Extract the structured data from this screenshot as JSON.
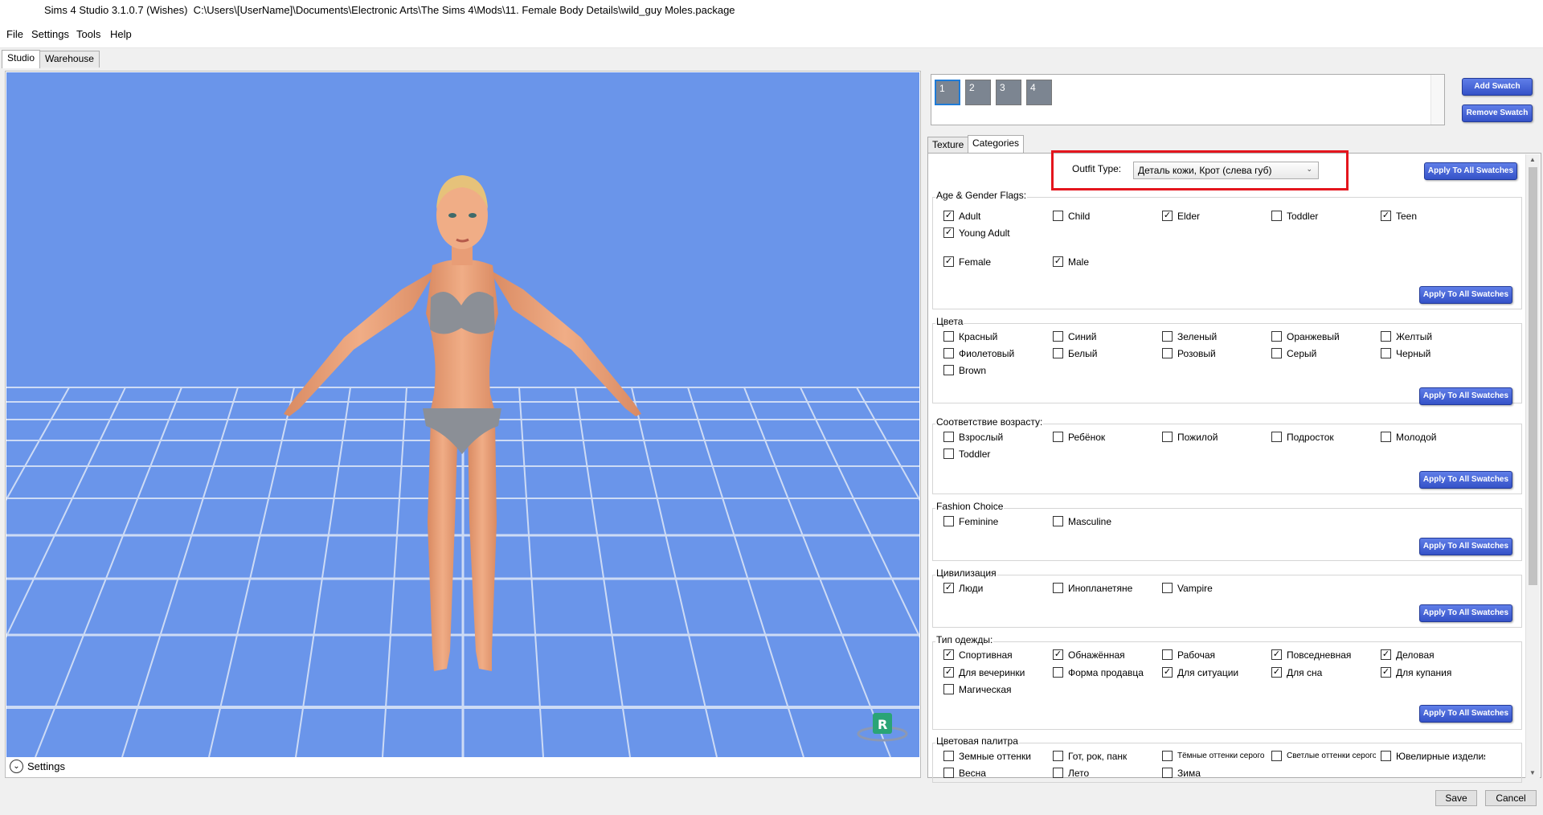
{
  "window": {
    "title": "Sims 4 Studio 3.1.0.7 (Wishes)  C:\\Users\\[UserName]\\Documents\\Electronic Arts\\The Sims 4\\Mods\\11. Female Body Details\\wild_guy Moles.package"
  },
  "menu": [
    "File",
    "Settings",
    "Tools",
    "Help"
  ],
  "main_tabs": [
    "Studio",
    "Warehouse"
  ],
  "viewport": {
    "settings_label": "Settings",
    "badge": "R"
  },
  "swatches": {
    "items": [
      "1",
      "2",
      "3",
      "4"
    ],
    "selected": "1",
    "add_label": "Add Swatch",
    "remove_label": "Remove Swatch"
  },
  "sub_tabs": [
    "Texture",
    "Categories"
  ],
  "outfit": {
    "label": "Outfit Type:",
    "value": "Деталь кожи, Крот (слева губ)"
  },
  "apply_label": "Apply To All Swatches",
  "groups": [
    {
      "label": "Age & Gender Flags:",
      "rows": [
        [
          {
            "t": "Adult",
            "c": true
          },
          {
            "t": "Child",
            "c": false
          },
          {
            "t": "Elder",
            "c": true
          },
          {
            "t": "Toddler",
            "c": false
          },
          {
            "t": "Teen",
            "c": true
          }
        ],
        [
          {
            "t": "Young Adult",
            "c": true
          }
        ],
        [],
        [
          {
            "t": "Female",
            "c": true
          },
          {
            "t": "Male",
            "c": true
          }
        ]
      ]
    },
    {
      "label": "Цвета",
      "rows": [
        [
          {
            "t": "Красный",
            "c": false
          },
          {
            "t": "Синий",
            "c": false
          },
          {
            "t": "Зеленый",
            "c": false
          },
          {
            "t": "Оранжевый",
            "c": false
          },
          {
            "t": "Желтый",
            "c": false
          }
        ],
        [
          {
            "t": "Фиолетовый",
            "c": false
          },
          {
            "t": "Белый",
            "c": false
          },
          {
            "t": "Розовый",
            "c": false
          },
          {
            "t": "Серый",
            "c": false
          },
          {
            "t": "Черный",
            "c": false
          }
        ],
        [
          {
            "t": "Brown",
            "c": false
          }
        ]
      ]
    },
    {
      "label": "Соответствие возрасту:",
      "rows": [
        [
          {
            "t": "Взрослый",
            "c": false
          },
          {
            "t": "Ребёнок",
            "c": false
          },
          {
            "t": "Пожилой",
            "c": false
          },
          {
            "t": "Подросток",
            "c": false
          },
          {
            "t": "Молодой",
            "c": false
          }
        ],
        [
          {
            "t": "Toddler",
            "c": false
          }
        ]
      ]
    },
    {
      "label": "Fashion Choice",
      "rows": [
        [
          {
            "t": "Feminine",
            "c": false
          },
          {
            "t": "Masculine",
            "c": false
          }
        ]
      ]
    },
    {
      "label": "Цивилизация",
      "rows": [
        [
          {
            "t": "Люди",
            "c": true
          },
          {
            "t": "Инопланетяне",
            "c": false
          },
          {
            "t": "Vampire",
            "c": false
          }
        ]
      ]
    },
    {
      "label": "Тип одежды:",
      "rows": [
        [
          {
            "t": "Спортивная",
            "c": true
          },
          {
            "t": "Обнажённая",
            "c": true
          },
          {
            "t": "Рабочая",
            "c": false
          },
          {
            "t": "Повседневная",
            "c": true
          },
          {
            "t": "Деловая",
            "c": true
          }
        ],
        [
          {
            "t": "Для вечеринки",
            "c": true
          },
          {
            "t": "Форма продавца",
            "c": false
          },
          {
            "t": "Для ситуации",
            "c": true
          },
          {
            "t": "Для сна",
            "c": true
          },
          {
            "t": "Для купания",
            "c": true
          }
        ],
        [
          {
            "t": "Магическая",
            "c": false
          }
        ]
      ]
    },
    {
      "label": "Цветовая палитра",
      "rows": [
        [
          {
            "t": "Земные оттенки",
            "c": false
          },
          {
            "t": "Гот, рок, панк",
            "c": false
          },
          {
            "t": "Тёмные оттенки серого",
            "c": false
          },
          {
            "t": "Светлые оттенки серого",
            "c": false
          },
          {
            "t": "Ювелирные изделия",
            "c": false
          }
        ],
        [
          {
            "t": "Весна",
            "c": false
          },
          {
            "t": "Лето",
            "c": false
          },
          {
            "t": "Зима",
            "c": false
          }
        ]
      ]
    }
  ],
  "footer": {
    "save": "Save",
    "cancel": "Cancel"
  },
  "colors": {
    "viewport_bg": "#6a95ea",
    "accent_button": "#3e5cd0",
    "highlight": "#e4151d"
  }
}
